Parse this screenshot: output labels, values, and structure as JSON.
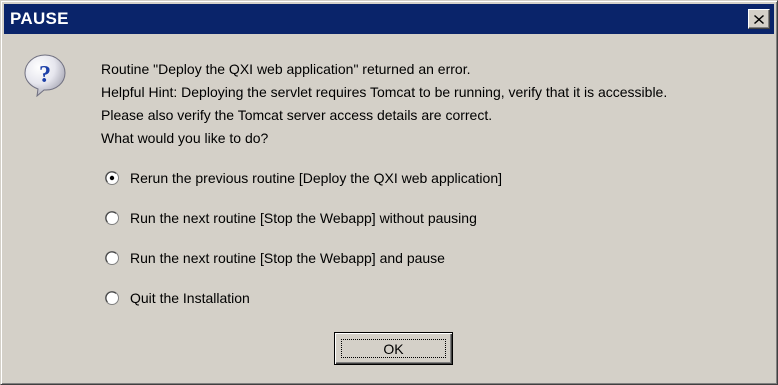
{
  "window": {
    "title": "PAUSE",
    "close_icon": "close-icon"
  },
  "icon": "question-icon",
  "message": {
    "line1": "Routine \"Deploy the QXI web application\" returned an error.",
    "line2": "Helpful Hint: Deploying the servlet requires Tomcat to be running, verify that it is accessible.",
    "line3": "Please also verify the Tomcat server access details are correct.",
    "line4": "What would you like to do?"
  },
  "options": [
    {
      "label": "Rerun the previous routine [Deploy the QXI web application]",
      "selected": true
    },
    {
      "label": "Run the next routine [Stop the Webapp] without pausing",
      "selected": false
    },
    {
      "label": "Run the next routine [Stop the Webapp] and pause",
      "selected": false
    },
    {
      "label": "Quit the Installation",
      "selected": false
    }
  ],
  "buttons": {
    "ok_label": "OK"
  },
  "colors": {
    "titlebar": "#0a246a",
    "face": "#d4d0c8"
  }
}
